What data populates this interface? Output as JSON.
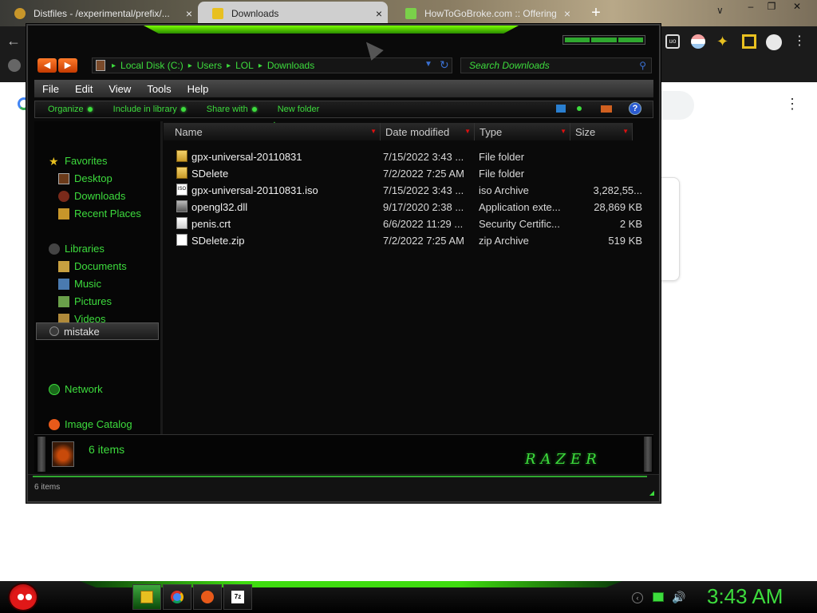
{
  "browser": {
    "tabs": [
      {
        "title": "Distfiles - /experimental/prefix/...",
        "close": "×"
      },
      {
        "title": "Downloads",
        "close": "×"
      },
      {
        "title": "HowToGoBroke.com :: Offering",
        "close": "×"
      }
    ],
    "new_tab": "+",
    "tab_menu": "∨",
    "window_controls": {
      "minimize": "–",
      "maximize": "❐",
      "close": "✕"
    },
    "back": "←",
    "menu": "⋮",
    "card_close": "×"
  },
  "explorer": {
    "nav": {
      "back": "◀",
      "forward": "▶"
    },
    "address": {
      "crumbs": [
        "Local Disk (C:)",
        "Users",
        "LOL",
        "Downloads"
      ],
      "separator": "▸",
      "dropdown": "▼",
      "refresh": "↻"
    },
    "search": {
      "placeholder": "Search Downloads",
      "icon": "search-icon"
    },
    "menubar": [
      "File",
      "Edit",
      "View",
      "Tools",
      "Help"
    ],
    "commands": [
      "Organize",
      "Include in library",
      "Share with",
      "New folder"
    ],
    "help_icon": "?",
    "navpane": {
      "favorites": {
        "label": "Favorites",
        "items": [
          "Desktop",
          "Downloads",
          "Recent Places"
        ]
      },
      "libraries": {
        "label": "Libraries",
        "items": [
          "Documents",
          "Music",
          "Pictures",
          "Videos"
        ]
      },
      "selected": "mistake",
      "network": "Network",
      "image_catalog": "Image Catalog"
    },
    "columns": [
      "Name",
      "Date modified",
      "Type",
      "Size"
    ],
    "sort_indicator": "▲",
    "column_arrow": "▼",
    "files": [
      {
        "name": "gpx-universal-20110831",
        "date": "7/15/2022 3:43 ...",
        "type": "File folder",
        "size": "",
        "icon": "folder-icon"
      },
      {
        "name": "SDelete",
        "date": "7/2/2022 7:25 AM",
        "type": "File folder",
        "size": "",
        "icon": "folder-icon"
      },
      {
        "name": "gpx-universal-20110831.iso",
        "date": "7/15/2022 3:43 ...",
        "type": "iso Archive",
        "size": "3,282,55...",
        "icon": "iso-icon"
      },
      {
        "name": "opengl32.dll",
        "date": "9/17/2020 2:38 ...",
        "type": "Application exte...",
        "size": "28,869 KB",
        "icon": "dll-icon"
      },
      {
        "name": "penis.crt",
        "date": "6/6/2022 11:29 ...",
        "type": "Security Certific...",
        "size": "2 KB",
        "icon": "certificate-icon"
      },
      {
        "name": "SDelete.zip",
        "date": "7/2/2022 7:25 AM",
        "type": "zip Archive",
        "size": "519 KB",
        "icon": "zip-icon"
      }
    ],
    "iso_label": "ISO",
    "details_count": "6 items",
    "logo_text": "RAZER",
    "status_text": "6 items",
    "resize_grip": "◢"
  },
  "taskbar": {
    "clock": "3:43 AM",
    "tasks": [
      "explorer-icon",
      "chrome-icon",
      "flash-icon",
      "7zip-icon"
    ],
    "tray_arrow": "‹",
    "volume": "🔊",
    "accent": "#3ddc3d"
  }
}
